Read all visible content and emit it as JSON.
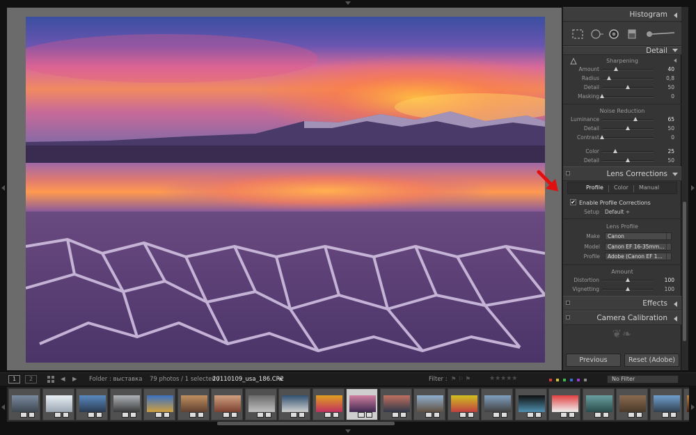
{
  "panel": {
    "histogram": "Histogram",
    "detail": "Detail",
    "sharpening": {
      "title": "Sharpening",
      "rows": [
        {
          "label": "Amount",
          "value": "40",
          "pos": 0.27
        },
        {
          "label": "Radius",
          "value": "0,8",
          "pos": 0.14
        },
        {
          "label": "Detail",
          "value": "50",
          "pos": 0.5
        },
        {
          "label": "Masking",
          "value": "0",
          "pos": 0.0
        }
      ]
    },
    "noise": {
      "title": "Noise Reduction",
      "rows": [
        {
          "label": "Luminance",
          "value": "65",
          "pos": 0.65
        },
        {
          "label": "Detail",
          "value": "50",
          "pos": 0.5
        },
        {
          "label": "Contrast",
          "value": "0",
          "pos": 0.0
        },
        {
          "label": "Color",
          "value": "25",
          "pos": 0.25
        },
        {
          "label": "Detail",
          "value": "50",
          "pos": 0.5
        }
      ]
    },
    "lens": {
      "title": "Lens Corrections",
      "tabs": [
        "Profile",
        "Color",
        "Manual"
      ],
      "enable_label": "Enable Profile Corrections",
      "enable_checked": "✔",
      "setup_label": "Setup",
      "setup_value": "Default ÷",
      "profile_heading": "Lens Profile",
      "make_label": "Make",
      "make_value": "Canon",
      "model_label": "Model",
      "model_value": "Canon EF 16-35mm…",
      "profile_label": "Profile",
      "profile_value": "Adobe (Canon EF 1…",
      "amount_heading": "Amount",
      "amount_rows": [
        {
          "label": "Distortion",
          "value": "100",
          "pos": 0.5
        },
        {
          "label": "Vignetting",
          "value": "100",
          "pos": 0.5
        }
      ]
    },
    "effects": "Effects",
    "calibration": "Camera Calibration",
    "previous": "Previous",
    "reset": "Reset (Adobe)"
  },
  "filmstrip": {
    "view1": "1",
    "view2": "2",
    "folder": "Folder : выставка",
    "count": "79 photos / 1 selected /",
    "filename": "20110109_usa_186.CR2",
    "filename_caret": "▾",
    "filter_label": "Filter :",
    "filter_value": "No Filter",
    "stars": "★★★★★",
    "label_colors": [
      "#d23a3a",
      "#d2c23a",
      "#3ab84a",
      "#3a6ad2",
      "#9a3ad2",
      "#8a8a8a"
    ]
  },
  "thumbs": [
    {
      "top": "#7a8aa0",
      "bottom": "#3c4650"
    },
    {
      "top": "#e8eef4",
      "bottom": "#9aa6b2"
    },
    {
      "top": "#5a8ac0",
      "bottom": "#2a3a50"
    },
    {
      "top": "#b0b4b8",
      "bottom": "#3a3a3a"
    },
    {
      "top": "#3a70c0",
      "bottom": "#d0a040"
    },
    {
      "top": "#c09060",
      "bottom": "#604030"
    },
    {
      "top": "#d0a080",
      "bottom": "#7a4030"
    },
    {
      "top": "#6a6a6a",
      "bottom": "#c0c0c0"
    },
    {
      "top": "#305070",
      "bottom": "#d0d0d0"
    },
    {
      "top": "#e0a020",
      "bottom": "#c03060"
    },
    {
      "top": "#d080a0",
      "bottom": "#402850"
    },
    {
      "top": "#c07060",
      "bottom": "#303848"
    },
    {
      "top": "#90b0d0",
      "bottom": "#605040"
    },
    {
      "top": "#d0c020",
      "bottom": "#c04040"
    },
    {
      "top": "#80a0c0",
      "bottom": "#404040"
    },
    {
      "top": "#101010",
      "bottom": "#5090b0"
    },
    {
      "top": "#e04040",
      "bottom": "#f0f0f0"
    },
    {
      "top": "#6aa0a0",
      "bottom": "#2a4a4a"
    },
    {
      "top": "#8a6a50",
      "bottom": "#4a3a2a"
    },
    {
      "top": "#70a0d0",
      "bottom": "#304050"
    },
    {
      "top": "#c08040",
      "bottom": "#402010"
    }
  ]
}
